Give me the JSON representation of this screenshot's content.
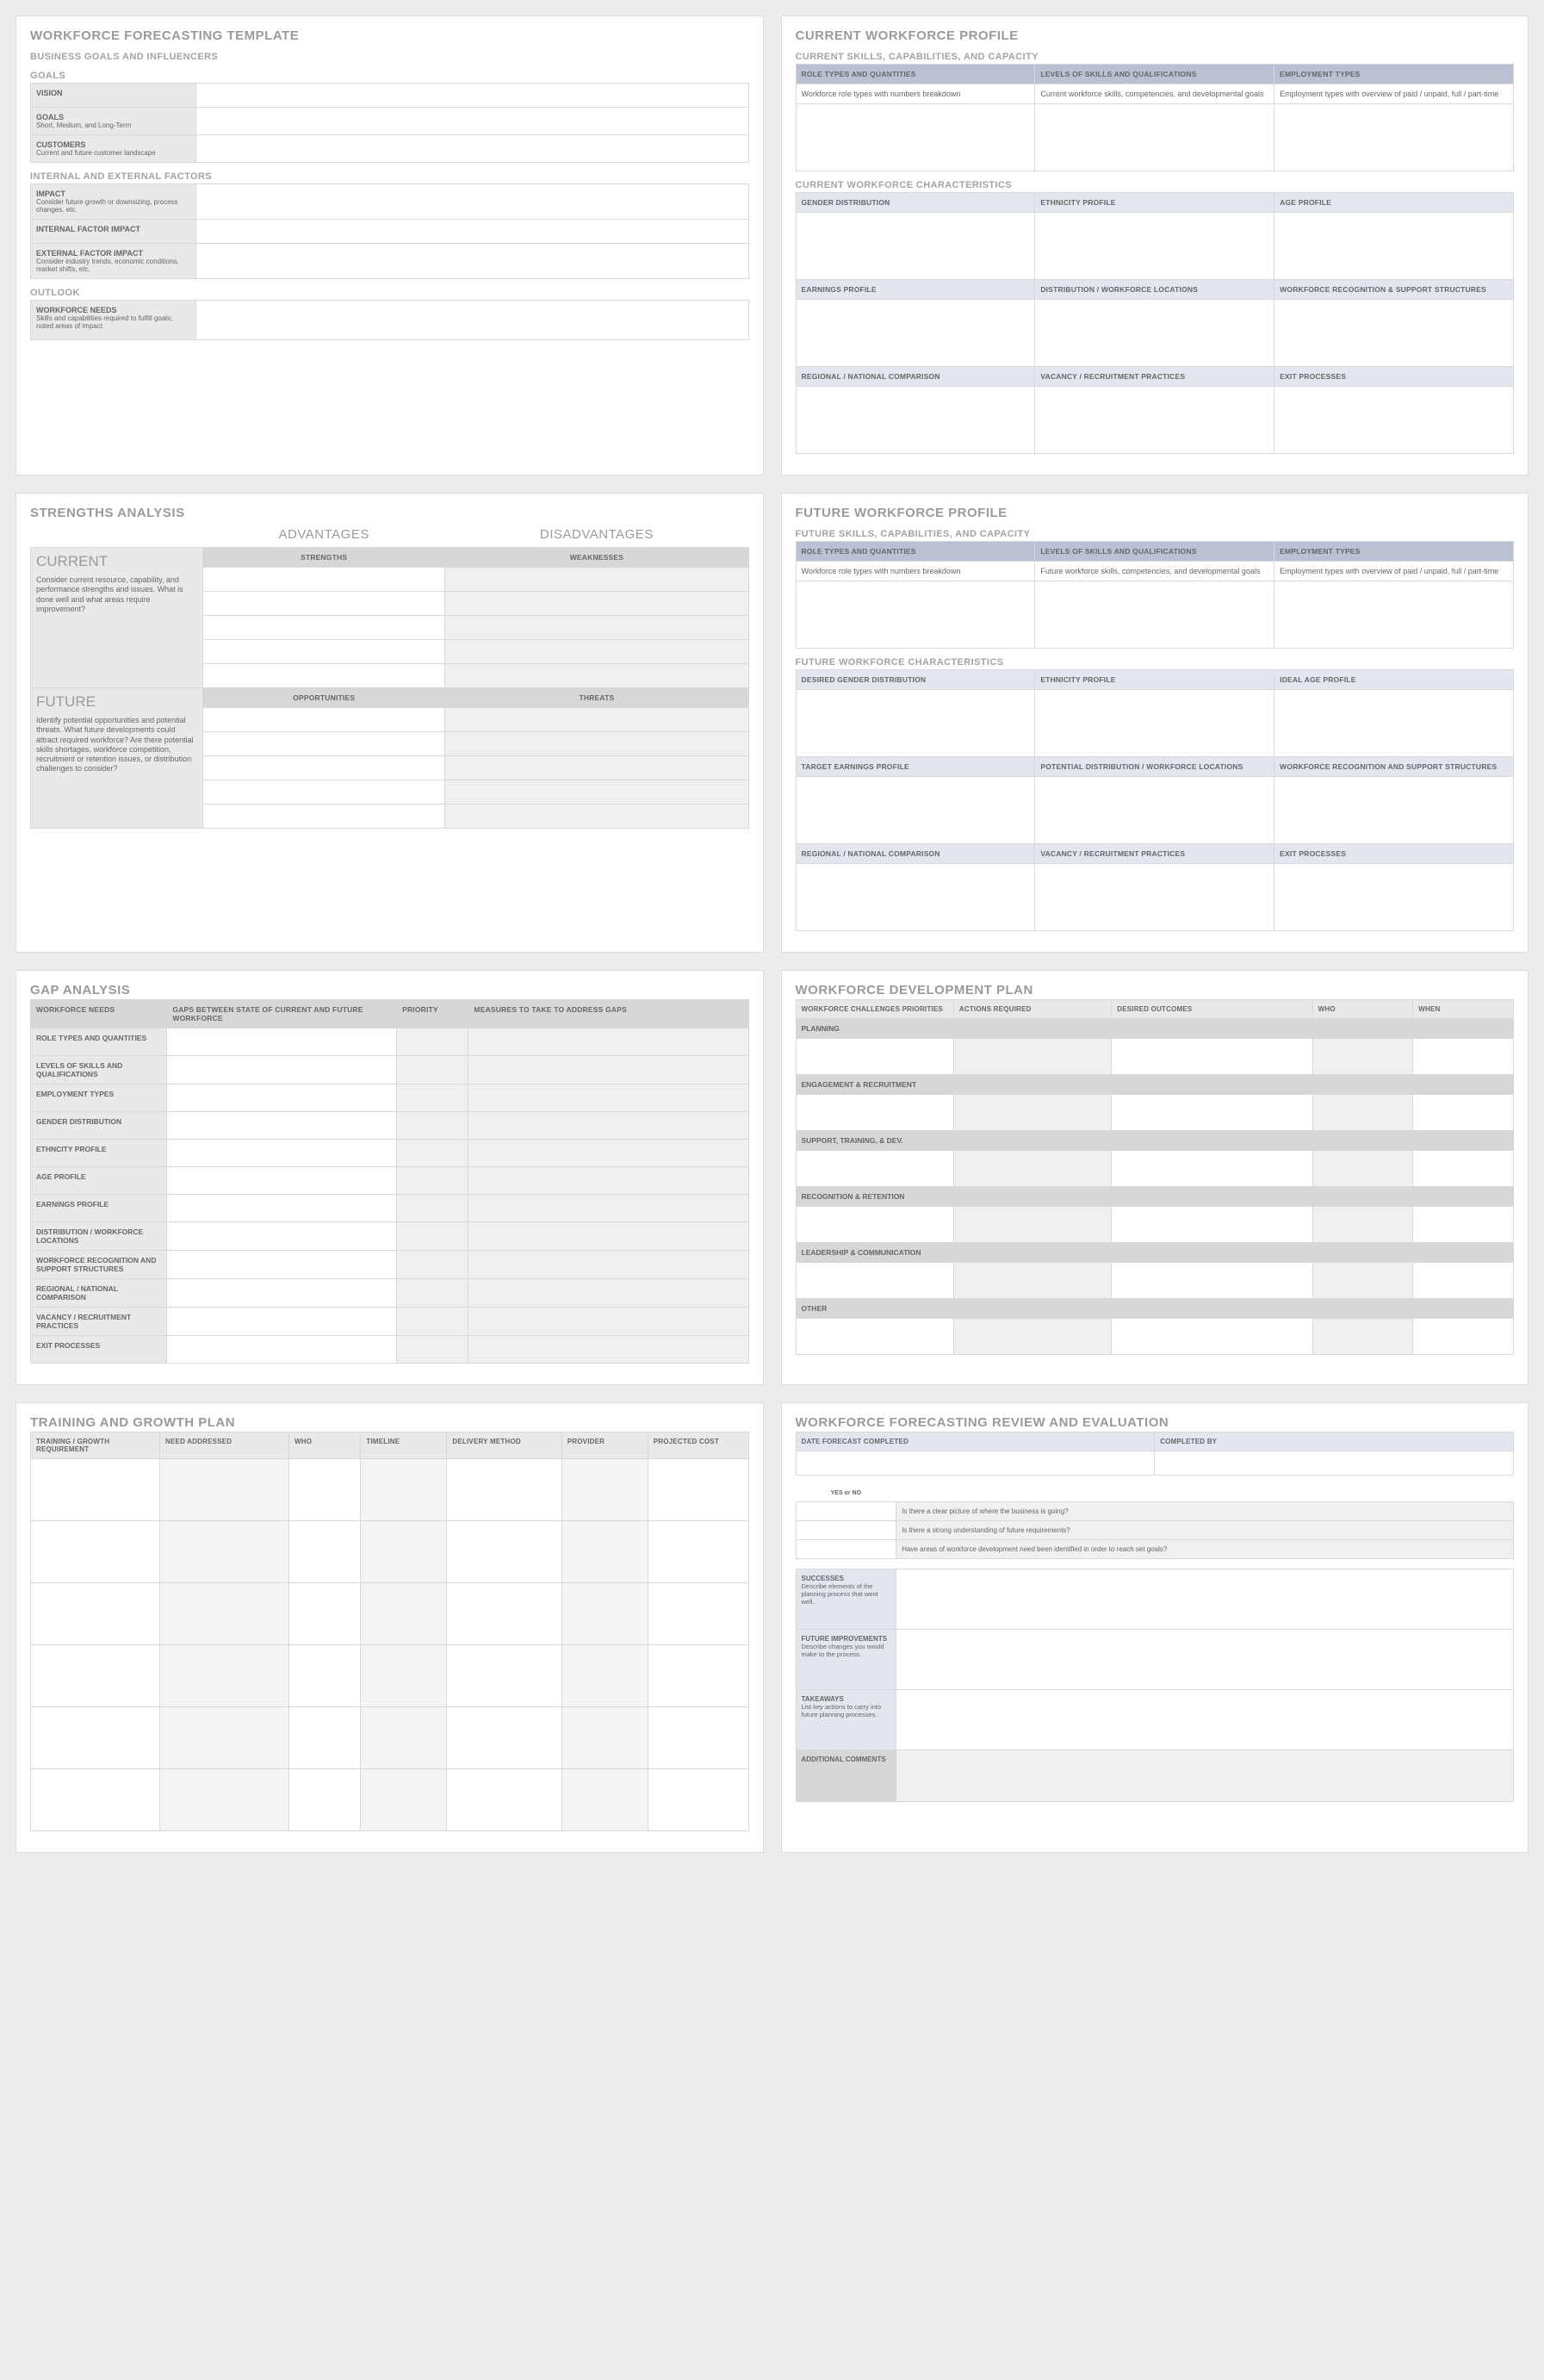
{
  "p1": {
    "title": "WORKFORCE FORECASTING TEMPLATE",
    "sub1": "BUSINESS GOALS AND INFLUENCERS",
    "goals": "GOALS",
    "vision": "VISION",
    "goalsRow": "GOALS",
    "goalsSub": "Short, Medium, and Long-Term",
    "customers": "CUSTOMERS",
    "customersSub": "Current and future customer landscape",
    "internalExternal": "INTERNAL AND EXTERNAL FACTORS",
    "impact": "IMPACT",
    "impactSub": "Consider future growth or downsizing, process changes, etc.",
    "internalImpact": "INTERNAL FACTOR IMPACT",
    "externalImpact": "EXTERNAL FACTOR IMPACT",
    "externalSub": "Consider industry trends, economic conditions, market shifts, etc.",
    "outlook": "OUTLOOK",
    "wfNeeds": "WORKFORCE NEEDS",
    "wfNeedsSub": "Skills and capabilities required to fulfill goals; noted areas of impact"
  },
  "p2": {
    "title": "CURRENT WORKFORCE PROFILE",
    "sub1": "CURRENT SKILLS, CAPABILITIES, AND CAPACITY",
    "h1": "ROLE TYPES AND QUANTITIES",
    "h2": "LEVELS OF SKILLS AND QUALIFICATIONS",
    "h3": "EMPLOYMENT TYPES",
    "c1": "Workforce role types with numbers breakdown",
    "c2": "Current workforce skills, competencies, and developmental goals",
    "c3": "Employment types with overview of paid / unpaid, full / part-time",
    "sub2": "CURRENT WORKFORCE CHARACTERISTICS",
    "gh1": "GENDER DISTRIBUTION",
    "gh2": "ETHNICITY PROFILE",
    "gh3": "AGE PROFILE",
    "gh4": "EARNINGS PROFILE",
    "gh5": "DISTRIBUTION / WORKFORCE LOCATIONS",
    "gh6": "WORKFORCE RECOGNITION & SUPPORT STRUCTURES",
    "gh7": "REGIONAL / NATIONAL COMPARISON",
    "gh8": "VACANCY / RECRUITMENT PRACTICES",
    "gh9": "EXIT PROCESSES"
  },
  "p3": {
    "title": "STRENGTHS ANALYSIS",
    "adv": "ADVANTAGES",
    "dis": "DISADVANTAGES",
    "str": "STRENGTHS",
    "wkn": "WEAKNESSES",
    "opp": "OPPORTUNITIES",
    "thr": "THREATS",
    "cur": "CURRENT",
    "curTxt": "Consider current resource, capability, and performance strengths and issues.  What is done well and what areas require improvement?",
    "fut": "FUTURE",
    "futTxt": "Identify potential opportunities and potential threats. What future developments could attract required workforce?  Are there potential skills shortages, workforce competition, recruitment or retention issues, or distribution challenges to consider?"
  },
  "p4": {
    "title": "FUTURE WORKFORCE PROFILE",
    "sub1": "FUTURE SKILLS, CAPABILITIES, AND CAPACITY",
    "h1": "ROLE TYPES AND QUANTITIES",
    "h2": "LEVELS OF SKILLS AND QUALIFICATIONS",
    "h3": "EMPLOYMENT TYPES",
    "c1": "Workforce role types with numbers breakdown",
    "c2": "Future workforce skills, competencies, and developmental goals",
    "c3": "Employment types with overview of paid / unpaid, full / part-time",
    "sub2": "FUTURE WORKFORCE CHARACTERISTICS",
    "gh1": "DESIRED GENDER DISTRIBUTION",
    "gh2": "ETHNICITY PROFILE",
    "gh3": "IDEAL AGE PROFILE",
    "gh4": "TARGET EARNINGS PROFILE",
    "gh5": "POTENTIAL DISTRIBUTION / WORKFORCE LOCATIONS",
    "gh6": "WORKFORCE RECOGNITION AND SUPPORT STRUCTURES",
    "gh7": "REGIONAL / NATIONAL COMPARISON",
    "gh8": "VACANCY / RECRUITMENT PRACTICES",
    "gh9": "EXIT PROCESSES"
  },
  "p5": {
    "title": "GAP ANALYSIS",
    "h1": "WORKFORCE NEEDS",
    "h2": "GAPS BETWEEN STATE OF CURRENT AND FUTURE WORKFORCE",
    "h3": "PRIORITY",
    "h4": "MEASURES TO TAKE TO ADDRESS GAPS",
    "r1": "ROLE TYPES AND QUANTITIES",
    "r2": "LEVELS OF SKILLS AND QUALIFICATIONS",
    "r3": "EMPLOYMENT TYPES",
    "r4": "GENDER DISTRIBUTION",
    "r5": "ETHNCITY PROFILE",
    "r6": "AGE PROFILE",
    "r7": "EARNINGS PROFILE",
    "r8": "DISTRIBUTION / WORKFORCE LOCATIONS",
    "r9": "WORKFORCE RECOGNITION AND SUPPORT STRUCTURES",
    "r10": "REGIONAL / NATIONAL COMPARISON",
    "r11": "VACANCY / RECRUITMENT PRACTICES",
    "r12": "EXIT PROCESSES"
  },
  "p6": {
    "title": "WORKFORCE DEVELOPMENT PLAN",
    "h1": "WORKFORCE CHALLENGES PRIORITIES",
    "h2": "ACTIONS REQUIRED",
    "h3": "DESIRED OUTCOMES",
    "h4": "WHO",
    "h5": "WHEN",
    "r1": "PLANNING",
    "r2": "ENGAGEMENT & RECRUITMENT",
    "r3": "SUPPORT, TRAINING, & DEV.",
    "r4": "RECOGNITION & RETENTION",
    "r5": "LEADERSHIP & COMMUNICATION",
    "r6": "OTHER"
  },
  "p7": {
    "title": "TRAINING AND GROWTH PLAN",
    "h1": "TRAINING / GROWTH REQUIREMENT",
    "h2": "NEED ADDRESSED",
    "h3": "WHO",
    "h4": "TIMELINE",
    "h5": "DELIVERY METHOD",
    "h6": "PROVIDER",
    "h7": "PROJECTED COST"
  },
  "p8": {
    "title": "WORKFORCE FORECASTING REVIEW AND EVALUATION",
    "h1": "DATE FORECAST COMPLETED",
    "h2": "COMPLETED BY",
    "yn": "YES or NO",
    "q1": "Is there a clear picture of where the business is going?",
    "q2": "Is there a strong understanding of future requirements?",
    "q3": "Have areas of workforce development need been identified in order to reach set goals?",
    "s1": "SUCCESSES",
    "s1s": "Describe elements of the planning process that went well.",
    "s2": "FUTURE IMPROVEMENTS",
    "s2s": "Describe changes you would make to the process.",
    "s3": "TAKEAWAYS",
    "s3s": "List key actions to carry into future planning processes.",
    "s4": "ADDITIONAL COMMENTS"
  }
}
